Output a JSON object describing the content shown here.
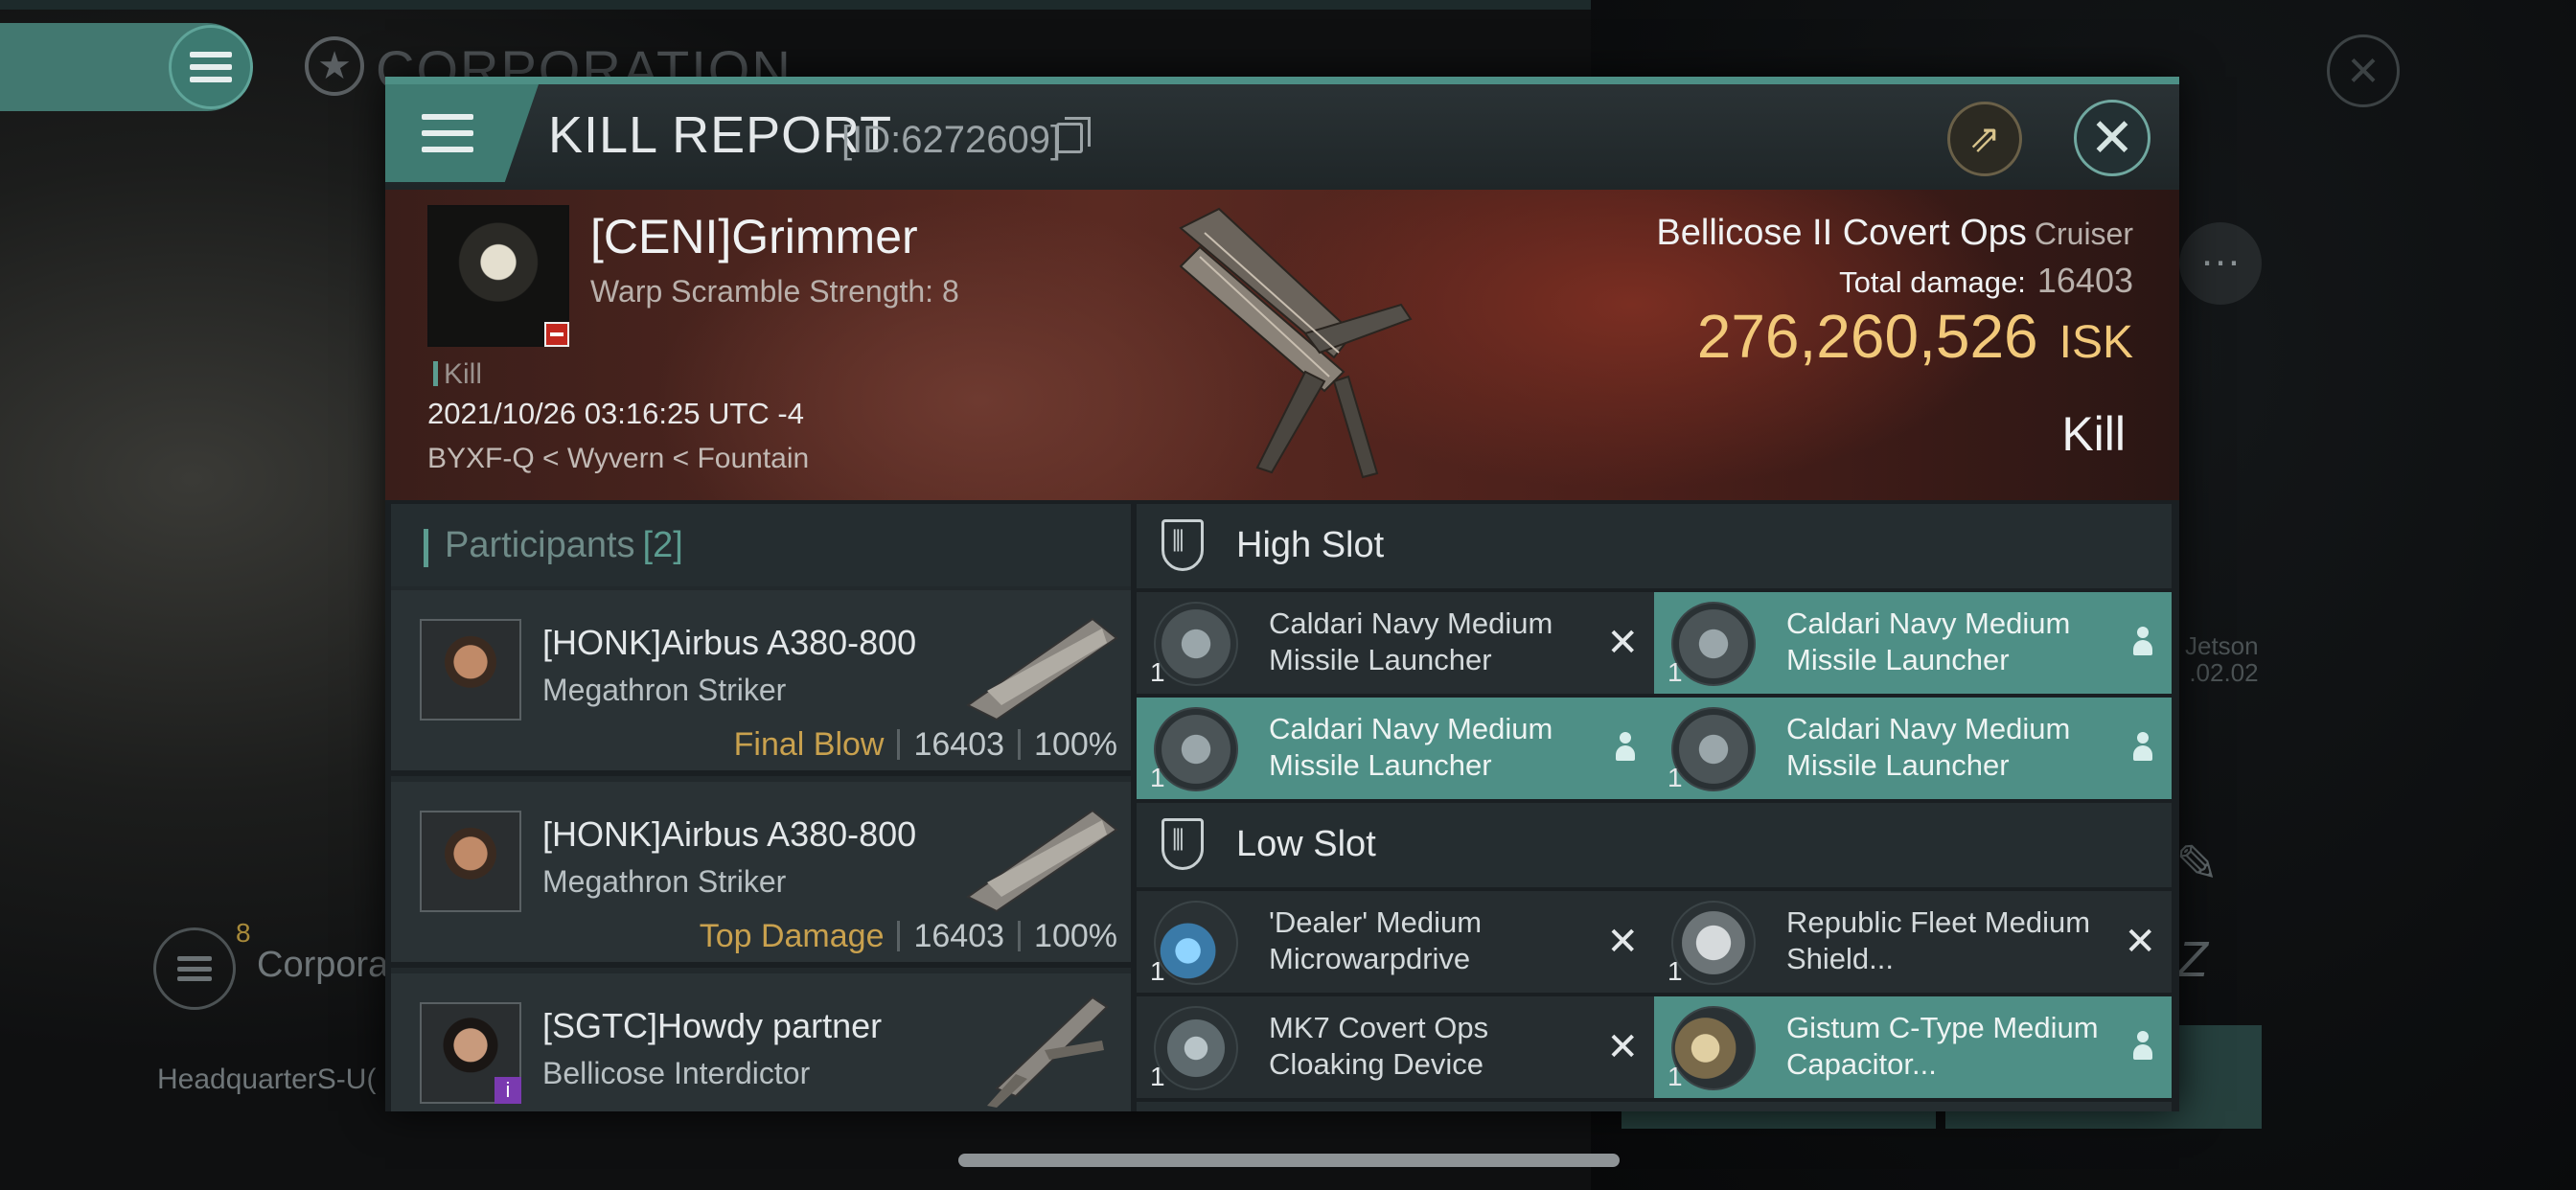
{
  "background": {
    "section_title": "CORPORATION",
    "corp_label": "Corpora",
    "corp_badge": "8",
    "hq_label": "HeadquarterS-U(",
    "jetson_line1": "Jetson",
    "jetson_line2": ".02.02"
  },
  "dialog": {
    "title": "KILL REPORT",
    "id_label": "[ID:6272609]",
    "icons": [
      "menu-icon",
      "copy-icon",
      "share-icon",
      "close-icon"
    ]
  },
  "victim": {
    "name": "[CENI]Grimmer",
    "subtitle": "Warp Scramble Strength: 8",
    "kill_tag": "Kill",
    "date": "2021/10/26 03:16:25 UTC -4",
    "location": "BYXF-Q < Wyvern < Fountain",
    "ship": "Bellicose II Covert Ops",
    "ship_class": "Cruiser",
    "total_damage_label": "Total damage:",
    "total_damage": "16403",
    "isk_value": "276,260,526",
    "isk_unit": "ISK",
    "result": "Kill"
  },
  "participants": {
    "title": "Participants",
    "count": "[2]",
    "rows": [
      {
        "name": "[HONK]Airbus A380-800",
        "ship": "Megathron Striker",
        "tag": "Final Blow",
        "damage": "16403",
        "percent": "100%"
      },
      {
        "name": "[HONK]Airbus A380-800",
        "ship": "Megathron Striker",
        "tag": "Top Damage",
        "damage": "16403",
        "percent": "100%"
      },
      {
        "name": "[SGTC]Howdy partner",
        "ship": "Bellicose Interdictor",
        "tag": "",
        "damage": "",
        "percent": ""
      }
    ]
  },
  "fitting": {
    "high_slot_title": "High Slot",
    "low_slot_title": "Low Slot",
    "high": [
      {
        "qty": "1",
        "name": "Caldari Navy Medium Missile Launcher",
        "status": "destroyed"
      },
      {
        "qty": "1",
        "name": "Caldari Navy Medium Missile Launcher",
        "status": "dropped"
      },
      {
        "qty": "1",
        "name": "Caldari Navy Medium Missile Launcher",
        "status": "dropped"
      },
      {
        "qty": "1",
        "name": "Caldari Navy Medium Missile Launcher",
        "status": "dropped"
      }
    ],
    "low": [
      {
        "qty": "1",
        "name": "'Dealer' Medium Microwarpdrive",
        "status": "destroyed"
      },
      {
        "qty": "1",
        "name": "Republic Fleet Medium Shield...",
        "status": "destroyed"
      },
      {
        "qty": "1",
        "name": "MK7 Covert Ops Cloaking Device",
        "status": "destroyed"
      },
      {
        "qty": "1",
        "name": "Gistum C-Type Medium Capacitor...",
        "status": "dropped"
      }
    ]
  },
  "colors": {
    "accent_teal": "#4e8f86",
    "isk_gold": "#f2c97a",
    "final_blow": "#c9a14e"
  }
}
